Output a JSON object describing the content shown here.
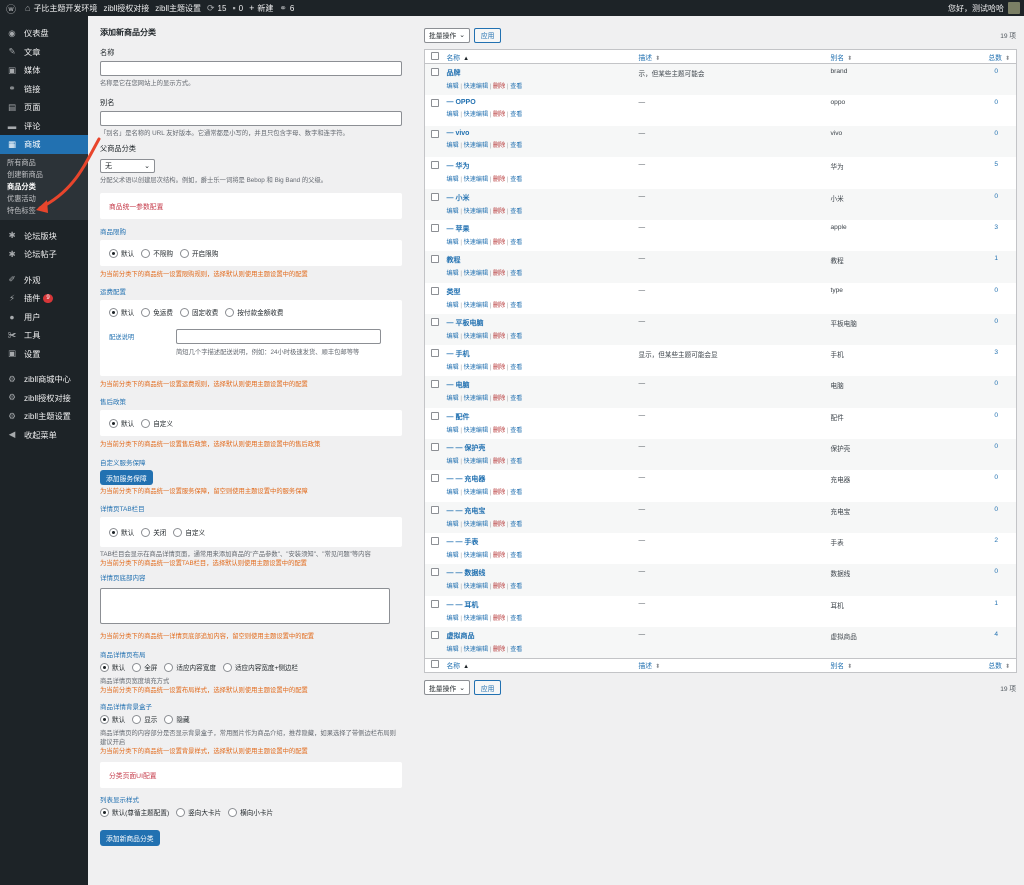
{
  "adminbar": {
    "site_name": "子比主题开发环境",
    "links": [
      "zibll授权对接",
      "zibll主题设置"
    ],
    "updates": "15",
    "comments": "0",
    "new_label": "新建",
    "links_count": "6",
    "greeting": "您好，测试哈哈"
  },
  "sidebar": {
    "items_top": [
      {
        "label": "仪表盘",
        "icon": "dashboard-icon",
        "glyph": "◉"
      },
      {
        "label": "文章",
        "icon": "pin-icon",
        "glyph": "✎"
      },
      {
        "label": "媒体",
        "icon": "media-icon",
        "glyph": "▣"
      },
      {
        "label": "链接",
        "icon": "link-icon",
        "glyph": "⚭"
      },
      {
        "label": "页面",
        "icon": "page-icon",
        "glyph": "▤"
      },
      {
        "label": "评论",
        "icon": "comment-icon",
        "glyph": "▬"
      }
    ],
    "shop": {
      "label": "商城",
      "icon": "store-icon",
      "glyph": "▦"
    },
    "shop_sub": [
      "所有商品",
      "创建新商品",
      "商品分类",
      "优惠活动",
      "特色标签"
    ],
    "active_sub_index": 2,
    "items_mid": [
      {
        "label": "论坛版块",
        "icon": "forum-icon",
        "glyph": "✱"
      },
      {
        "label": "论坛帖子",
        "icon": "forum-post-icon",
        "glyph": "✱"
      }
    ],
    "items_bottom": [
      {
        "label": "外观",
        "icon": "appearance-icon",
        "glyph": "✐"
      },
      {
        "label": "插件",
        "icon": "plugin-icon",
        "glyph": "⚡",
        "badge": "9"
      },
      {
        "label": "用户",
        "icon": "user-icon",
        "glyph": "●"
      },
      {
        "label": "工具",
        "icon": "tool-icon",
        "glyph": "✀"
      },
      {
        "label": "设置",
        "icon": "settings-icon",
        "glyph": "▣"
      }
    ],
    "items_zibll": [
      {
        "label": "zibll商城中心",
        "icon": "gear-icon",
        "glyph": "⚙"
      },
      {
        "label": "zibll授权对接",
        "icon": "gear-icon",
        "glyph": "⚙"
      },
      {
        "label": "zibll主题设置",
        "icon": "gear-icon",
        "glyph": "⚙"
      },
      {
        "label": "收起菜单",
        "icon": "collapse-icon",
        "glyph": "◀"
      }
    ]
  },
  "form": {
    "heading": "添加新商品分类",
    "name_label": "名称",
    "name_desc": "名称是它在您网站上的显示方式。",
    "slug_label": "别名",
    "slug_desc": "「别名」是名称的 URL 友好版本。它通常都是小写的，并且只包含字母、数字和连字符。",
    "parent_label": "父商品分类",
    "parent_value": "无",
    "parent_desc": "分配父术语以创建层次结构。例如，爵士乐一词将是 Bebop 和 Big Band 的父级。",
    "config_title": "商品统一参数配置",
    "limit_label": "商品限购",
    "limit_options": [
      "默认",
      "不限购",
      "开启限购"
    ],
    "limit_note": "为当前分类下的商品统一设置限购规则，选择默认则使用主题设置中的配置",
    "shipping_label": "运费配置",
    "shipping_options": [
      "默认",
      "免运费",
      "固定收费",
      "按付款金额收费"
    ],
    "shipping_desc_label": "配送说明",
    "shipping_desc_hint": "简短几个字描述配送说明，例如：24小时极速发货、顺丰包邮等等",
    "shipping_note": "为当前分类下的商品统一设置运费规则，选择默认则使用主题设置中的配置",
    "aftersale_label": "售后政策",
    "aftersale_options": [
      "默认",
      "自定义"
    ],
    "aftersale_note": "为当前分类下的商品统一设置售后政策，选择默认则使用主题设置中的售后政策",
    "guarantee_label": "自定义服务保障",
    "guarantee_button": "添加服务保障",
    "guarantee_note": "为当前分类下的商品统一设置服务保障，留空则使用主题设置中的服务保障",
    "tab_label": "详情页TAB栏目",
    "tab_options": [
      "默认",
      "关闭",
      "自定义"
    ],
    "tab_desc": "TAB栏目会显示在商品详情页面，通常用来添加商品的\"产品参数\"、\"安装须知\"、\"常见问题\"等内容",
    "tab_note": "为当前分类下的商品统一设置TAB栏目，选择默认则使用主题设置中的配置",
    "footer_label": "详情页底部内容",
    "footer_note": "为当前分类下的商品统一详情页底部追加内容，留空则使用主题设置中的配置",
    "layout_label": "商品详情页布局",
    "layout_options": [
      "默认",
      "全屏",
      "适应内容宽度",
      "适应内容宽度+侧边栏"
    ],
    "layout_desc": "商品详情页宽度填充方式",
    "layout_note": "为当前分类下的商品统一设置布局样式，选择默认则使用主题设置中的配置",
    "bgbox_label": "商品详情背景盒子",
    "bgbox_options": [
      "默认",
      "显示",
      "隐藏"
    ],
    "bgbox_desc": "商品详情页的内容部分是否显示背景盒子，常用图片作为商品介绍，推荐隐藏，如果选择了带侧边栏布局则建议开启",
    "bgbox_note": "为当前分类下的商品统一设置背景样式，选择默认则使用主题设置中的配置",
    "ui_title": "分类页面UI配置",
    "list_style_label": "列表显示样式",
    "list_style_options": [
      "默认(尊循主题配置)",
      "竖向大卡片",
      "横向小卡片"
    ],
    "submit": "添加新商品分类"
  },
  "list": {
    "bulk_label": "批量操作",
    "apply_label": "应用",
    "count_label": "19 项",
    "columns": {
      "name": "名称",
      "desc": "描述",
      "slug": "别名",
      "count": "总数"
    },
    "row_actions": [
      "编辑",
      "快速编辑",
      "删除",
      "查看"
    ],
    "rows": [
      {
        "name": "品牌",
        "desc": "示，但某些主题可能会",
        "slug": "brand",
        "count": "0"
      },
      {
        "name": "— OPPO",
        "desc": "—",
        "slug": "oppo",
        "count": "0"
      },
      {
        "name": "— vivo",
        "desc": "—",
        "slug": "vivo",
        "count": "0"
      },
      {
        "name": "— 华为",
        "desc": "—",
        "slug": "华为",
        "count": "5"
      },
      {
        "name": "— 小米",
        "desc": "—",
        "slug": "小米",
        "count": "0"
      },
      {
        "name": "— 苹果",
        "desc": "—",
        "slug": "apple",
        "count": "3"
      },
      {
        "name": "教程",
        "desc": "—",
        "slug": "教程",
        "count": "1"
      },
      {
        "name": "类型",
        "desc": "—",
        "slug": "type",
        "count": "0"
      },
      {
        "name": "— 平板电脑",
        "desc": "—",
        "slug": "平板电脑",
        "count": "0"
      },
      {
        "name": "— 手机",
        "desc": "显示，但某些主题可能会显",
        "slug": "手机",
        "count": "3"
      },
      {
        "name": "— 电脑",
        "desc": "—",
        "slug": "电脑",
        "count": "0"
      },
      {
        "name": "— 配件",
        "desc": "—",
        "slug": "配件",
        "count": "0"
      },
      {
        "name": "— — 保护壳",
        "desc": "—",
        "slug": "保护壳",
        "count": "0"
      },
      {
        "name": "— — 充电器",
        "desc": "—",
        "slug": "充电器",
        "count": "0"
      },
      {
        "name": "— — 充电宝",
        "desc": "—",
        "slug": "充电宝",
        "count": "0"
      },
      {
        "name": "— — 手表",
        "desc": "—",
        "slug": "手表",
        "count": "2"
      },
      {
        "name": "— — 数据线",
        "desc": "—",
        "slug": "数据线",
        "count": "0"
      },
      {
        "name": "— — 耳机",
        "desc": "—",
        "slug": "耳机",
        "count": "1"
      },
      {
        "name": "虚拟商品",
        "desc": "—",
        "slug": "虚拟商品",
        "count": "4"
      }
    ]
  },
  "colors": {
    "accent": "#2271b1",
    "sidebar": "#1d2327",
    "note": "#e26a1b",
    "section_title": "#c53b4a",
    "arrow": "#e8452c"
  }
}
